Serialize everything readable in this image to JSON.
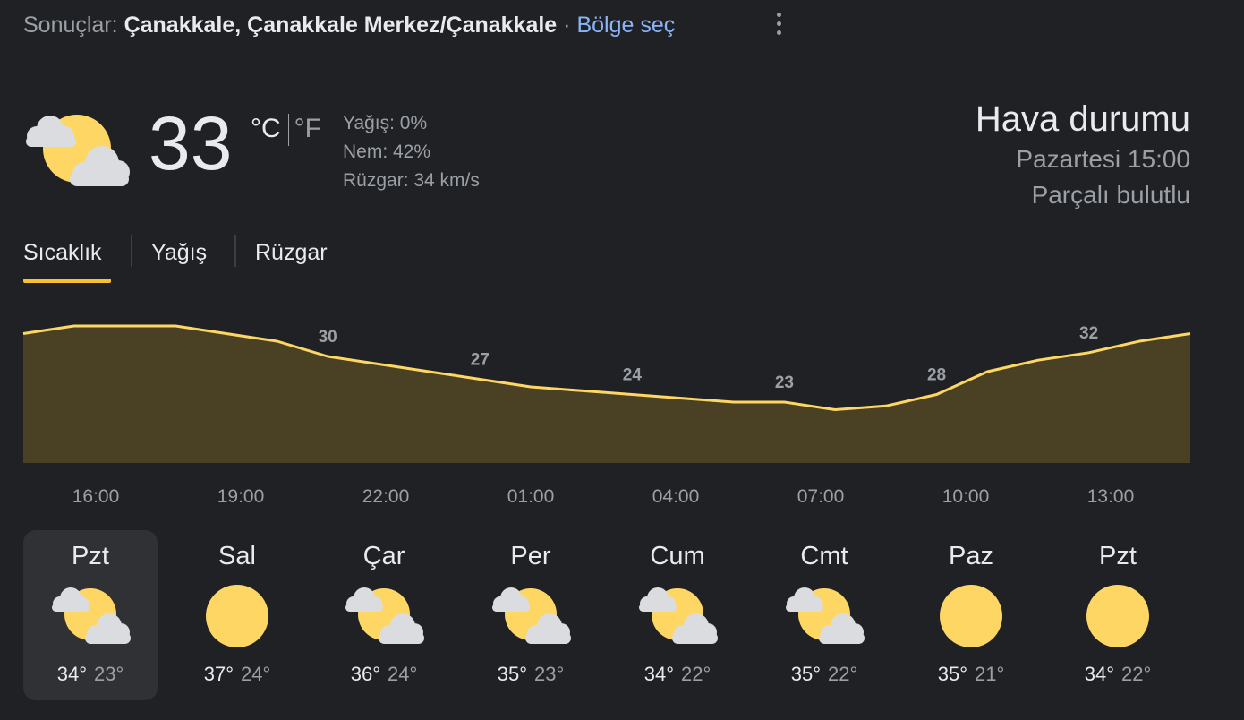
{
  "header": {
    "results_label": "Sonuçlar:",
    "location": "Çanakkale, Çanakkale Merkez/Çanakkale",
    "separator": "·",
    "region_link": "Bölge seç",
    "more_icon": "more-vert-icon"
  },
  "current": {
    "icon": "partly-cloudy-icon",
    "temperature": "33",
    "unit_c": "°C",
    "unit_f": "°F",
    "precipitation": "Yağış: 0%",
    "humidity": "Nem: 42%",
    "wind": "Rüzgar: 34 km/s",
    "title": "Hava durumu",
    "time": "Pazartesi 15:00",
    "condition": "Parçalı bulutlu"
  },
  "tabs": [
    {
      "label": "Sıcaklık",
      "selected": true
    },
    {
      "label": "Yağış",
      "selected": false
    },
    {
      "label": "Rüzgar",
      "selected": false
    }
  ],
  "chart_data": {
    "type": "area",
    "x": [
      "15:00",
      "16:00",
      "17:00",
      "18:00",
      "19:00",
      "20:00",
      "21:00",
      "22:00",
      "23:00",
      "00:00",
      "01:00",
      "02:00",
      "03:00",
      "04:00",
      "05:00",
      "06:00",
      "07:00",
      "08:00",
      "09:00",
      "10:00",
      "11:00",
      "12:00",
      "13:00",
      "14:00"
    ],
    "y": [
      33,
      34,
      34,
      34,
      33,
      32,
      30,
      29,
      28,
      27,
      26,
      25.5,
      25,
      24.5,
      24,
      24,
      23,
      23.5,
      25,
      28,
      29.5,
      30.5,
      32,
      33
    ],
    "labels": [
      {
        "index": 0,
        "value": "33"
      },
      {
        "index": 3,
        "value": "34"
      },
      {
        "index": 6,
        "value": "30"
      },
      {
        "index": 9,
        "value": "27"
      },
      {
        "index": 12,
        "value": "24"
      },
      {
        "index": 15,
        "value": "23"
      },
      {
        "index": 18,
        "value": "28"
      },
      {
        "index": 21,
        "value": "32"
      }
    ],
    "tick_labels": [
      "16:00",
      "19:00",
      "22:00",
      "01:00",
      "04:00",
      "07:00",
      "10:00",
      "13:00"
    ],
    "ylim": [
      16,
      36
    ],
    "line_color": "#fdd663",
    "fill_color": "#4a4124"
  },
  "days": [
    {
      "name": "Pzt",
      "icon": "partly-cloudy-icon",
      "high": "34°",
      "low": "23°",
      "selected": true
    },
    {
      "name": "Sal",
      "icon": "sunny-icon",
      "high": "37°",
      "low": "24°",
      "selected": false
    },
    {
      "name": "Çar",
      "icon": "partly-cloudy-icon",
      "high": "36°",
      "low": "24°",
      "selected": false
    },
    {
      "name": "Per",
      "icon": "partly-cloudy-icon",
      "high": "35°",
      "low": "23°",
      "selected": false
    },
    {
      "name": "Cum",
      "icon": "partly-cloudy-icon",
      "high": "34°",
      "low": "22°",
      "selected": false
    },
    {
      "name": "Cmt",
      "icon": "partly-cloudy-icon",
      "high": "35°",
      "low": "22°",
      "selected": false
    },
    {
      "name": "Paz",
      "icon": "sunny-icon",
      "high": "35°",
      "low": "21°",
      "selected": false
    },
    {
      "name": "Pzt",
      "icon": "sunny-icon",
      "high": "34°",
      "low": "22°",
      "selected": false
    }
  ]
}
